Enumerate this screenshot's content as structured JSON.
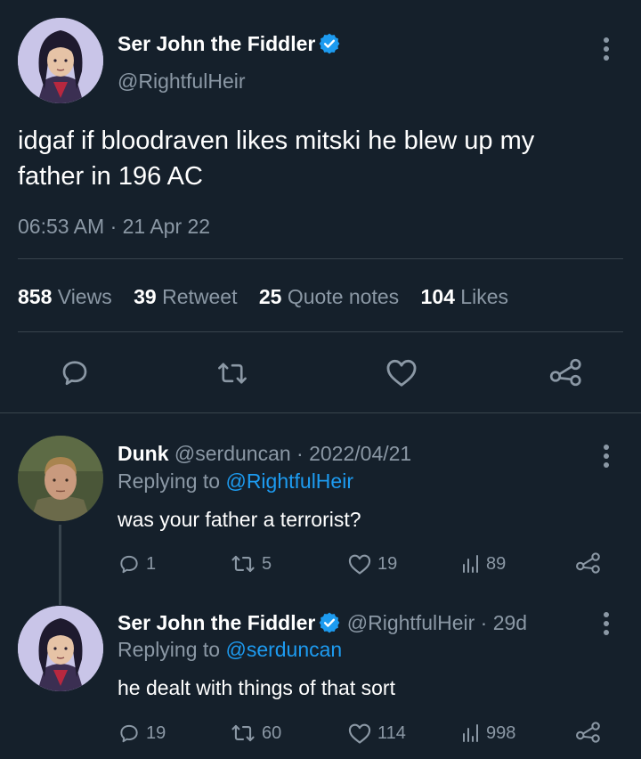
{
  "main_tweet": {
    "display_name": "Ser John the Fiddler",
    "handle": "@RightfulHeir",
    "text_line1": "idgaf if bloodraven likes mitski he blew up my",
    "text_line2": "father in 196 AC",
    "timestamp": "06:53 AM · 21 Apr 22",
    "stats": {
      "views_count": "858",
      "views_label": "Views",
      "retweet_count": "39",
      "retweet_label": "Retweet",
      "quote_count": "25",
      "quote_label": "Quote notes",
      "likes_count": "104",
      "likes_label": "Likes"
    }
  },
  "replies": [
    {
      "display_name": "Dunk",
      "handle": "@serduncan",
      "date": "· 2022/04/21",
      "replying_prefix": "Replying to",
      "replying_to": "@RightfulHeir",
      "text": "was your father a terrorist?",
      "replies": "1",
      "retweets": "5",
      "likes": "19",
      "views": "89"
    },
    {
      "display_name": "Ser John the Fiddler",
      "handle": "@RightfulHeir",
      "date": "· 29d",
      "replying_prefix": "Replying to",
      "replying_to": "@serduncan",
      "text": "he dealt with things of that sort",
      "replies": "19",
      "retweets": "60",
      "likes": "114",
      "views": "998"
    }
  ],
  "colors": {
    "background": "#15202b",
    "muted": "#8b98a5",
    "link": "#1d9bf0",
    "divider": "#38444d",
    "verified": "#1d9bf0"
  }
}
